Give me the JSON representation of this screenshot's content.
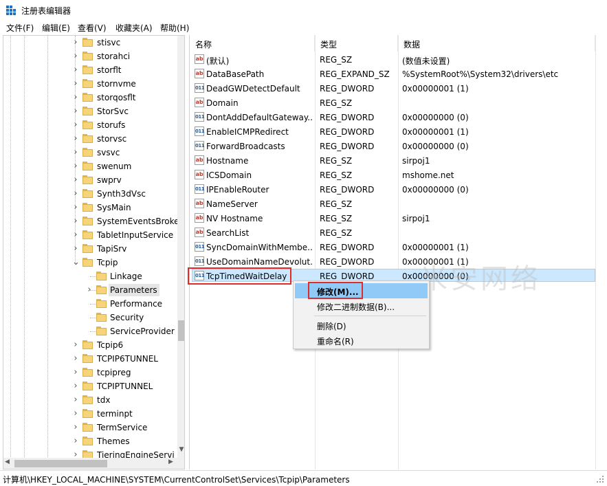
{
  "window": {
    "title": "注册表编辑器"
  },
  "menu": [
    {
      "label": "文件(F)"
    },
    {
      "label": "编辑(E)"
    },
    {
      "label": "查看(V)"
    },
    {
      "label": "收藏夹(A)"
    },
    {
      "label": "帮助(H)"
    }
  ],
  "tree": {
    "items": [
      {
        "label": "stisvc",
        "expandable": true,
        "level": 1
      },
      {
        "label": "storahci",
        "expandable": true,
        "level": 1
      },
      {
        "label": "storflt",
        "expandable": true,
        "level": 1
      },
      {
        "label": "stornvme",
        "expandable": true,
        "level": 1
      },
      {
        "label": "storqosflt",
        "expandable": true,
        "level": 1
      },
      {
        "label": "StorSvc",
        "expandable": true,
        "level": 1
      },
      {
        "label": "storufs",
        "expandable": true,
        "level": 1
      },
      {
        "label": "storvsc",
        "expandable": true,
        "level": 1
      },
      {
        "label": "svsvc",
        "expandable": true,
        "level": 1
      },
      {
        "label": "swenum",
        "expandable": true,
        "level": 1
      },
      {
        "label": "swprv",
        "expandable": true,
        "level": 1
      },
      {
        "label": "Synth3dVsc",
        "expandable": true,
        "level": 1
      },
      {
        "label": "SysMain",
        "expandable": true,
        "level": 1
      },
      {
        "label": "SystemEventsBroke",
        "expandable": true,
        "level": 1
      },
      {
        "label": "TabletInputService",
        "expandable": true,
        "level": 1
      },
      {
        "label": "TapiSrv",
        "expandable": true,
        "level": 1
      },
      {
        "label": "Tcpip",
        "expandable": true,
        "expanded": true,
        "level": 1
      },
      {
        "label": "Linkage",
        "expandable": false,
        "level": 2
      },
      {
        "label": "Parameters",
        "expandable": true,
        "selected": true,
        "level": 2
      },
      {
        "label": "Performance",
        "expandable": false,
        "level": 2
      },
      {
        "label": "Security",
        "expandable": false,
        "level": 2
      },
      {
        "label": "ServiceProvider",
        "expandable": false,
        "level": 2
      },
      {
        "label": "Tcpip6",
        "expandable": true,
        "level": 1
      },
      {
        "label": "TCPIP6TUNNEL",
        "expandable": true,
        "level": 1
      },
      {
        "label": "tcpipreg",
        "expandable": true,
        "level": 1
      },
      {
        "label": "TCPIPTUNNEL",
        "expandable": true,
        "level": 1
      },
      {
        "label": "tdx",
        "expandable": true,
        "level": 1
      },
      {
        "label": "terminpt",
        "expandable": true,
        "level": 1
      },
      {
        "label": "TermService",
        "expandable": true,
        "level": 1
      },
      {
        "label": "Themes",
        "expandable": true,
        "level": 1
      },
      {
        "label": "TieringEngineServi",
        "expandable": true,
        "level": 1
      }
    ]
  },
  "values": {
    "columns": {
      "name": "名称",
      "type": "类型",
      "data": "数据"
    },
    "rows": [
      {
        "icon": "string-value-icon",
        "name": "(默认)",
        "type": "REG_SZ",
        "data": "(数值未设置)"
      },
      {
        "icon": "string-value-icon",
        "name": "DataBasePath",
        "type": "REG_EXPAND_SZ",
        "data": "%SystemRoot%\\System32\\drivers\\etc"
      },
      {
        "icon": "dword-value-icon",
        "name": "DeadGWDetectDefault",
        "type": "REG_DWORD",
        "data": "0x00000001 (1)"
      },
      {
        "icon": "string-value-icon",
        "name": "Domain",
        "type": "REG_SZ",
        "data": ""
      },
      {
        "icon": "dword-value-icon",
        "name": "DontAddDefaultGateway...",
        "type": "REG_DWORD",
        "data": "0x00000000 (0)"
      },
      {
        "icon": "dword-value-icon",
        "name": "EnableICMPRedirect",
        "type": "REG_DWORD",
        "data": "0x00000001 (1)"
      },
      {
        "icon": "dword-value-icon",
        "name": "ForwardBroadcasts",
        "type": "REG_DWORD",
        "data": "0x00000000 (0)"
      },
      {
        "icon": "string-value-icon",
        "name": "Hostname",
        "type": "REG_SZ",
        "data": "sirpoj1"
      },
      {
        "icon": "string-value-icon",
        "name": "ICSDomain",
        "type": "REG_SZ",
        "data": "mshome.net"
      },
      {
        "icon": "dword-value-icon",
        "name": "IPEnableRouter",
        "type": "REG_DWORD",
        "data": "0x00000000 (0)"
      },
      {
        "icon": "string-value-icon",
        "name": "NameServer",
        "type": "REG_SZ",
        "data": ""
      },
      {
        "icon": "string-value-icon",
        "name": "NV Hostname",
        "type": "REG_SZ",
        "data": "sirpoj1"
      },
      {
        "icon": "string-value-icon",
        "name": "SearchList",
        "type": "REG_SZ",
        "data": ""
      },
      {
        "icon": "dword-value-icon",
        "name": "SyncDomainWithMembe...",
        "type": "REG_DWORD",
        "data": "0x00000001 (1)"
      },
      {
        "icon": "dword-value-icon",
        "name": "UseDomainNameDevolut...",
        "type": "REG_DWORD",
        "data": "0x00000001 (1)"
      },
      {
        "icon": "dword-value-icon",
        "name": "TcpTimedWaitDelay",
        "type": "REG_DWORD",
        "data": "0x00000000 (0)",
        "selected": true
      }
    ]
  },
  "context_menu": {
    "items": [
      {
        "label": "修改(M)...",
        "highlighted": true
      },
      {
        "label": "修改二进制数据(B)..."
      },
      {
        "label": "删除(D)"
      },
      {
        "label": "重命名(R)"
      }
    ]
  },
  "watermark": "米安网络",
  "status_bar": {
    "path": "计算机\\HKEY_LOCAL_MACHINE\\SYSTEM\\CurrentControlSet\\Services\\Tcpip\\Parameters"
  },
  "colors": {
    "selection": "#cce8ff",
    "menu_highlight": "#91c9f7",
    "annotation_red": "#e02b2b",
    "folder": "#f6d47a"
  }
}
